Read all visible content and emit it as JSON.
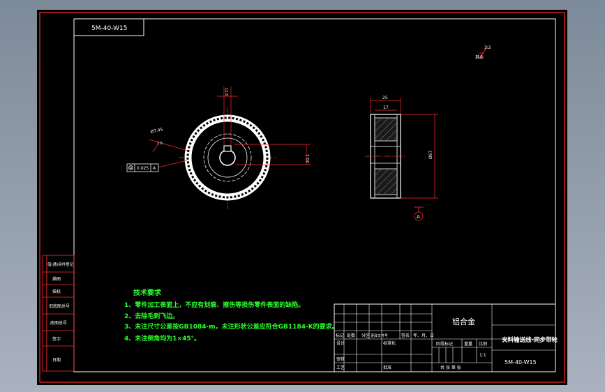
{
  "drawing": {
    "part_code_box": "5M-40-W15",
    "surface_mark": "3.2",
    "surface_mark_label": "其余",
    "dim_keyway_top": "12.8",
    "dim_chamfer": "Ø7.45",
    "dim_small": "1 6",
    "dim_key_height": "20.1",
    "tolerance_value": "0.025",
    "tolerance_datum": "A",
    "dim_width_total": "25",
    "dim_width_inner": "17",
    "dim_outer_diameter": "Ø67",
    "datum_label": "A"
  },
  "tech_requirements": {
    "title": "技术要求",
    "items": [
      "1、零件加工表面上，不应有划痕、擦伤等损伤零件表面的缺陷。",
      "2、去除毛刺飞边。",
      "3、未注尺寸公差按GB1084-m，未注形状公差应符合GB1184-K的要求。",
      "4、未注倒角均为1×45°。"
    ]
  },
  "title_block": {
    "material": "铝合金",
    "drawing_name": "夹料输送线-同步带轮",
    "drawing_code": "5M-40-W15",
    "scale": "1:1",
    "row_headers": [
      "标记",
      "处数",
      "分区",
      "更改文件号",
      "签名",
      "年、月、日"
    ],
    "design": "设计",
    "standardize": "标准化",
    "review": "审核",
    "process": "工艺",
    "approve": "批准",
    "stage_mark": "阶段标记",
    "weight": "重量",
    "ratio": "比例",
    "sheets": "共  张  第  张"
  },
  "side_strip": {
    "items": [
      "借(通)用件登记",
      "描图",
      "描校",
      "旧底图总号",
      "底图总号",
      "签字",
      "日期"
    ]
  },
  "colors": {
    "frame": "#ff2a2a",
    "outline": "#ffffff",
    "text_green": "#2cff2c",
    "paper": "#000000"
  }
}
